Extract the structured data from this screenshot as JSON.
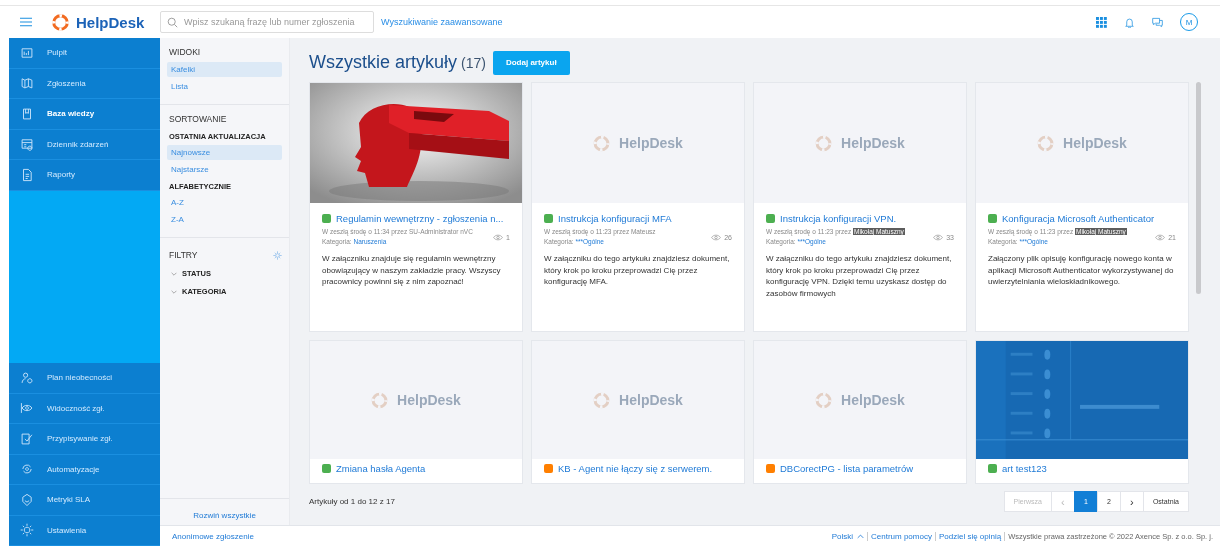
{
  "header": {
    "logo": "HelpDesk",
    "search": {
      "placeholder": "Wpisz szukaną frazę lub numer zgłoszenia"
    },
    "advanced_search": "Wyszukiwanie zaawansowane",
    "avatar": "M"
  },
  "sidebar": {
    "top_items": [
      {
        "label": "Pulpit",
        "selected": false
      },
      {
        "label": "Zgłoszenia",
        "selected": false
      },
      {
        "label": "Baza wiedzy",
        "selected": true
      },
      {
        "label": "Dziennik zdarzeń",
        "selected": false
      },
      {
        "label": "Raporty",
        "selected": false
      }
    ],
    "bottom_items": [
      {
        "label": "Plan nieobecności",
        "selected": false
      },
      {
        "label": "Widoczność zgł.",
        "selected": false
      },
      {
        "label": "Przypisywanie zgł.",
        "selected": false
      },
      {
        "label": "Automatyzacje",
        "selected": false
      },
      {
        "label": "Metryki SLA",
        "selected": false
      },
      {
        "label": "Ustawienia",
        "selected": false
      }
    ]
  },
  "filters_panel": {
    "sections": [
      {
        "title": "WIDOKI",
        "groups": [
          {
            "items": [
              {
                "label": "Kafelki",
                "selected": true
              },
              {
                "label": "Lista",
                "selected": false
              }
            ]
          }
        ]
      },
      {
        "title": "SORTOWANIE",
        "groups": [
          {
            "heading": "OSTATNIA AKTUALIZACJA",
            "items": [
              {
                "label": "Najnowsze",
                "selected": true
              },
              {
                "label": "Najstarsze",
                "selected": false
              }
            ]
          },
          {
            "heading": "ALFABETYCZNIE",
            "items": [
              {
                "label": "A-Z",
                "selected": false
              },
              {
                "label": "Z-A",
                "selected": false
              }
            ]
          }
        ]
      }
    ],
    "filters": {
      "title": "FILTRY",
      "items": [
        {
          "label": "STATUS",
          "expanded": false
        },
        {
          "label": "KATEGORIA",
          "expanded": false
        }
      ]
    },
    "expand_all": "Rozwiń wszystkie"
  },
  "content": {
    "title": "Wszystkie artykuły",
    "count": "(17)",
    "add_button": "Dodaj artykuł",
    "articles": [
      {
        "title": "Regulamin wewnętrzny - zgłoszenia n...",
        "color": "#4caf50",
        "meta": "W zeszłą środę o 11:34 przez SU-Administrator nVC",
        "views": "1",
        "category_label": "Kategoria:",
        "category": "Naruszenia",
        "description": "W załączniku znajduje się regulamin wewnętrzny obowiązujący w naszym zakładzie pracy. Wszyscy pracownicy powinni się z nim zapoznać!"
      },
      {
        "image": {
          "kind": "placeholder",
          "text": "HelpDesk"
        },
        "title": "Instrukcja konfiguracji MFA",
        "color": "#4caf50",
        "meta": "W zeszłą środę o 11:23 przez Mateusz",
        "views": "26",
        "category_label": "Kategoria:",
        "category": "***Ogólne",
        "description": "W załączniku do tego artykułu znajdziesz dokument, który krok po kroku przeprowadzi Cię przez konfigurację MFA."
      },
      {
        "image": {
          "kind": "placeholder",
          "text": "HelpDesk"
        },
        "title": "Instrukcja konfiguracji VPN.",
        "color": "#4caf50",
        "meta": "W zeszłą środę o 11:23 przez",
        "author": "Mikołaj Matuszny",
        "author_highlighted": true,
        "views": "33",
        "category_label": "Kategoria:",
        "category": "***Ogólne",
        "description": "W załączniku do tego artykułu znajdziesz dokument, który krok po kroku przeprowadzi Cię przez konfigurację VPN. Dzięki temu uzyskasz dostęp do zasobów firmowych"
      },
      {
        "image": {
          "kind": "placeholder",
          "text": "HelpDesk"
        },
        "title": "Konfiguracja Microsoft Authenticator",
        "color": "#4caf50",
        "meta": "W zeszłą środę o 11:23 przez",
        "author": "Mikołaj Matuszny",
        "author_highlighted": true,
        "views": "21",
        "category_label": "Kategoria:",
        "category": "***Ogólne",
        "description": "Załączony plik opisuję konfigurację nowego konta w aplikacji Microsoft Authenticator wykorzystywanej do uwierzytelniania wieloskładnikowego."
      },
      {
        "image": {
          "kind": "placeholder",
          "text": "HelpDesk"
        },
        "title": "Zmiana hasła Agenta",
        "color": "#4caf50"
      },
      {
        "image": {
          "kind": "placeholder",
          "text": "HelpDesk"
        },
        "title": "KB - Agent nie łączy się z serwerem.",
        "color": "#ff7f00"
      },
      {
        "image": {
          "kind": "placeholder",
          "text": "HelpDesk"
        },
        "title": "DBCorectPG - lista parametrów",
        "color": "#ff7f00"
      },
      {
        "title": "art test123",
        "color": "#4caf50"
      }
    ],
    "summary": "Artykuły od 1 do 12 z 17",
    "pagination": [
      {
        "label": "Pierwsza",
        "kind": "text",
        "selected": false,
        "disabled": true
      },
      {
        "label": "‹",
        "kind": "arrow",
        "selected": false,
        "disabled": true
      },
      {
        "label": "1",
        "kind": "page",
        "selected": true,
        "disabled": false
      },
      {
        "label": "2",
        "kind": "page",
        "selected": false,
        "disabled": false
      },
      {
        "label": "›",
        "kind": "arrow",
        "selected": false,
        "disabled": false
      },
      {
        "label": "Ostatnia",
        "kind": "text",
        "selected": false,
        "disabled": false
      }
    ]
  },
  "footer": {
    "anonymous": "Anonimowe zgłoszenie",
    "language": "Polski",
    "links": [
      "Centrum pomocy",
      "Podziel się opinią"
    ],
    "copyright": "Wszystkie prawa zastrzeżone © 2022 Axence Sp. z o.o. Sp. j."
  }
}
